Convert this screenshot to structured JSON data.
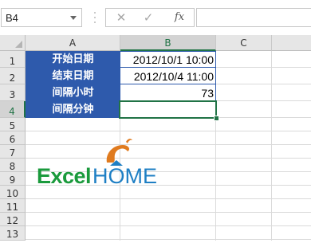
{
  "formula_bar": {
    "name_box": "B4",
    "cancel_glyph": "✕",
    "enter_glyph": "✓",
    "fx_label": "fx",
    "formula": ""
  },
  "columns": [
    "A",
    "B",
    "C"
  ],
  "rows": [
    "1",
    "2",
    "3",
    "4",
    "5",
    "6",
    "7",
    "8",
    "9",
    "10",
    "11",
    "12",
    "13"
  ],
  "cells": {
    "A1": "开始日期",
    "B1": "2012/10/1 10:00",
    "A2": "结束日期",
    "B2": "2012/10/4 11:00",
    "A3": "间隔小时",
    "B3": "73",
    "A4": "间隔分钟",
    "B4": ""
  },
  "selected_cell": "B4",
  "colors": {
    "label_fill": "#2e5aac",
    "selection": "#217346",
    "logo_green": "#1a9a3c",
    "logo_blue": "#1e7fc4",
    "logo_orange": "#e07b1f"
  },
  "logo": {
    "part1": "Excel",
    "part2": "HOME"
  }
}
